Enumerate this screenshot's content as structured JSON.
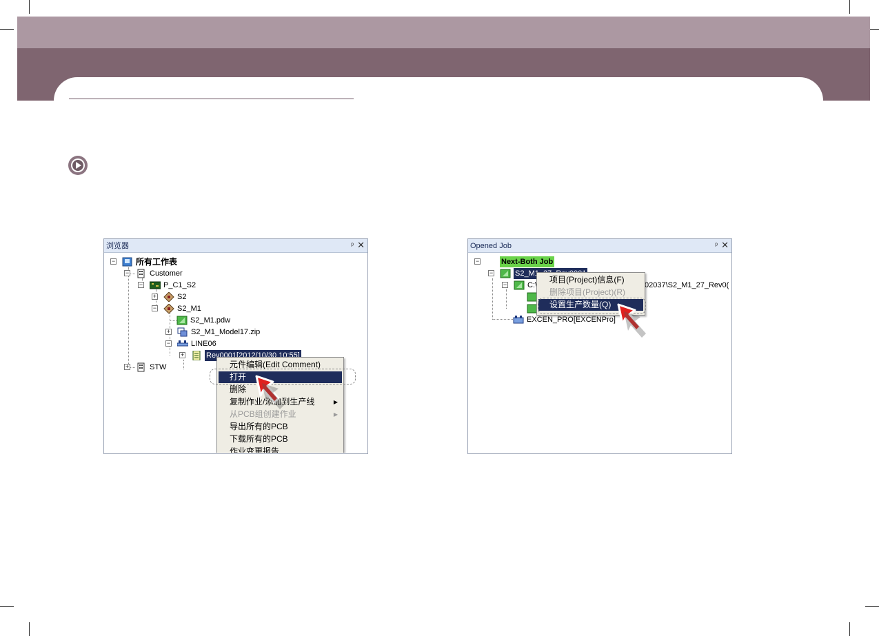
{
  "browser_panel": {
    "title": "浏览器",
    "pin_icon": "pin-icon",
    "close_icon": "close-icon",
    "tree": {
      "root": "所有工作表",
      "customer": "Customer",
      "pcb": "P_C1_S2",
      "s2": "S2",
      "s2m1": "S2_M1",
      "pdw": "S2_M1.pdw",
      "zip": "S2_M1_Model17.zip",
      "line": "LINE06",
      "rev": "Rev0001[2012/10/30 10:55]",
      "stw": "STW"
    },
    "context_menu": {
      "items": [
        "元件编辑(Edit Comment)",
        "打开",
        "删除",
        "复制作业/添加到生产线",
        "从PCB组创建作业",
        "导出所有的PCB",
        "下载所有的PCB",
        "作业变更报告"
      ],
      "active_index": 1,
      "disabled_index": 4
    }
  },
  "job_panel": {
    "title": "Opened Job",
    "tree": {
      "root": "Next-Both Job",
      "project": "S2_M1_27_Rev0001",
      "path_prefix": "C:\\",
      "path_suffix": "02037\\S2_M1_27_Rev0(",
      "machine": "EXCEN_PRO[EXCENPro]"
    },
    "context_menu": {
      "items": [
        "项目(Project)信息(F)",
        "删除项目(Project)(R)",
        "设置生产数量(Q)"
      ],
      "active_index": 2,
      "disabled_index": 1
    }
  },
  "colors": {
    "band_light": "#ac98a2",
    "band_dark": "#7f6570",
    "selection": "#1f2d5b",
    "highlight": "#6ad34a"
  }
}
